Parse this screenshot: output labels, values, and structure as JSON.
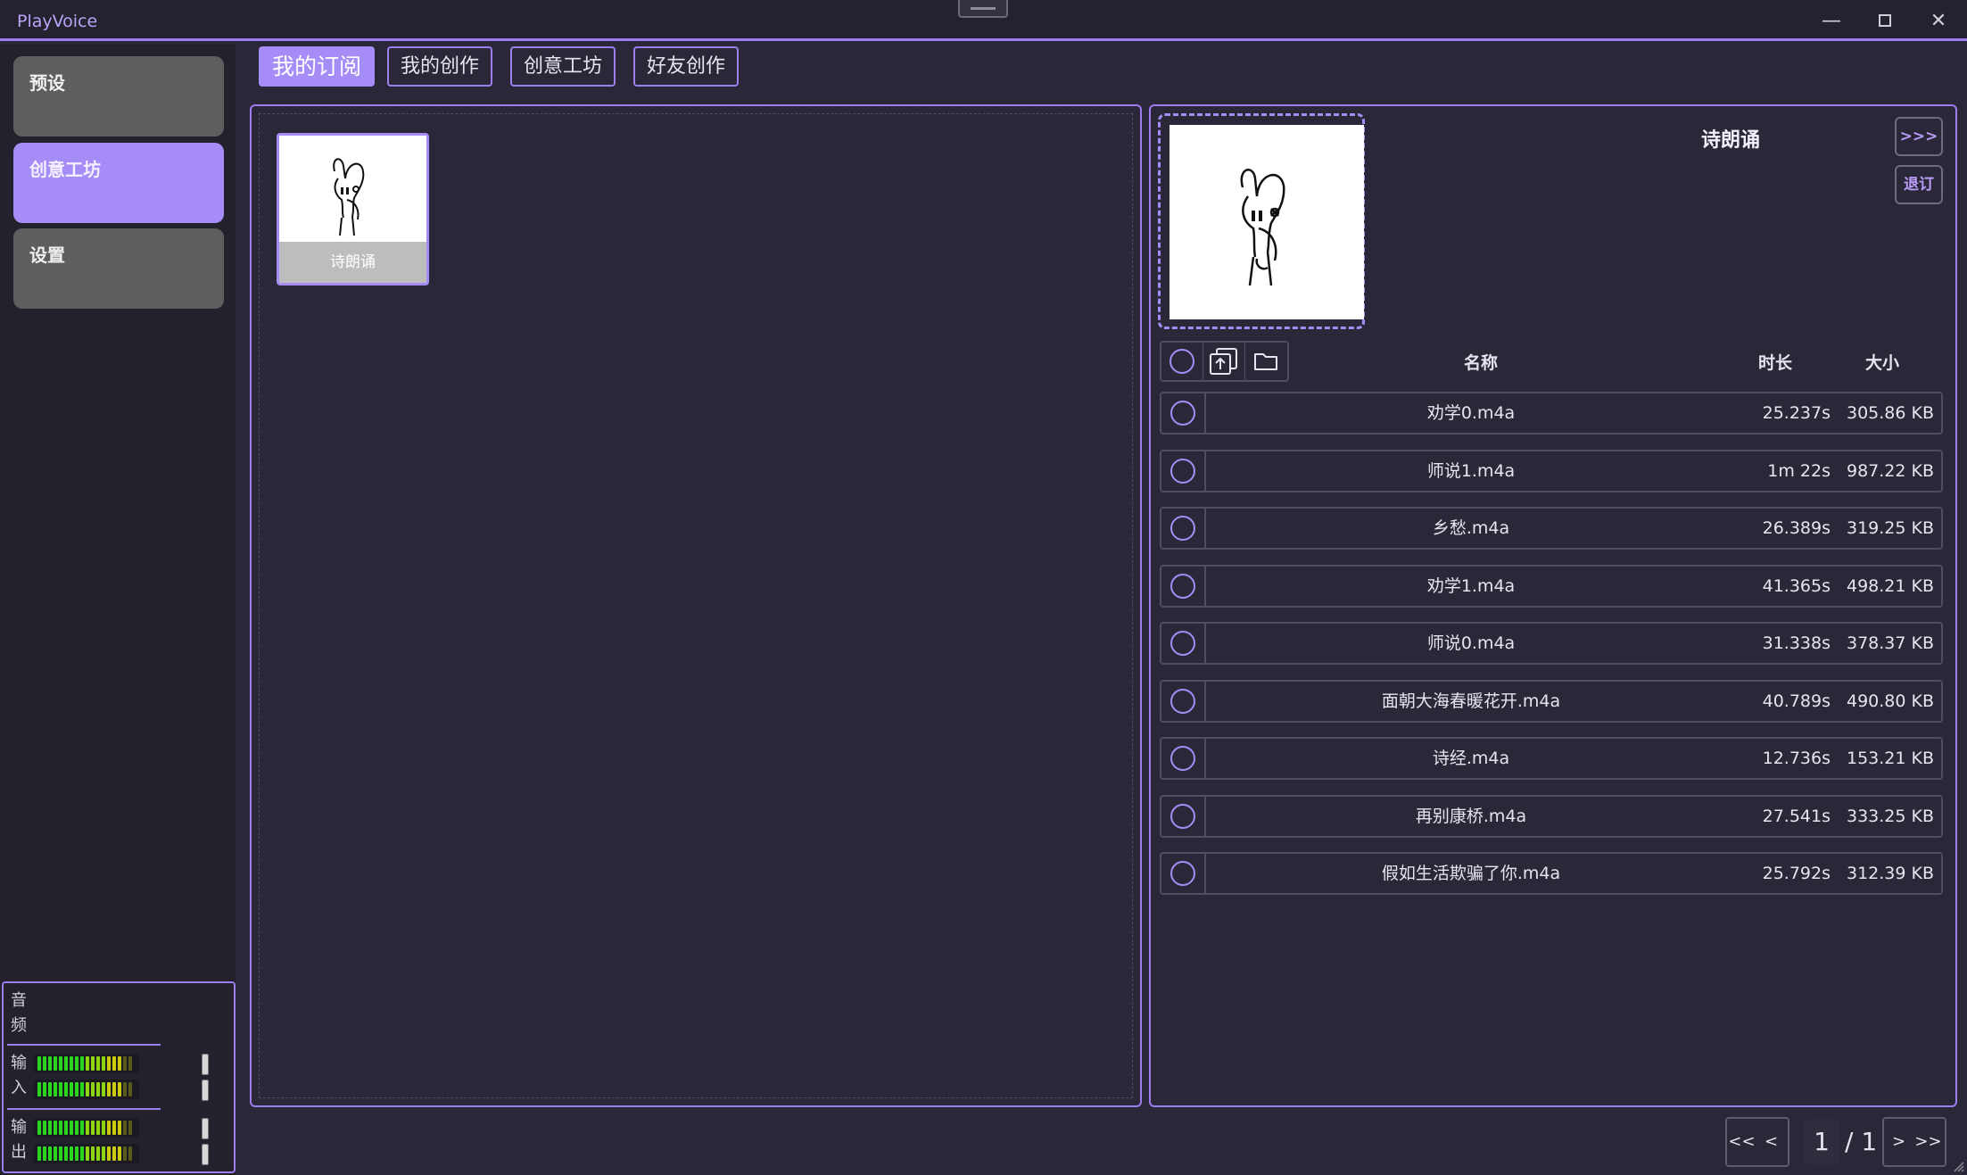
{
  "app": {
    "title": "PlayVoice"
  },
  "window": {
    "minimize": "—",
    "close": "✕"
  },
  "sidebar": {
    "items": [
      {
        "label": "预设",
        "active": false
      },
      {
        "label": "创意工坊",
        "active": true
      },
      {
        "label": "设置",
        "active": false
      }
    ]
  },
  "audio": {
    "title_line1": "音",
    "title_line2": "频",
    "input_line1": "输",
    "input_line2": "入",
    "output_line1": "输",
    "output_line2": "出"
  },
  "tabs": [
    {
      "label": "我的订阅",
      "active": true
    },
    {
      "label": "我的创作",
      "active": false
    },
    {
      "label": "创意工坊",
      "active": false
    },
    {
      "label": "好友创作",
      "active": false
    }
  ],
  "library": {
    "cards": [
      {
        "label": "诗朗诵"
      }
    ]
  },
  "detail": {
    "title": "诗朗诵",
    "expand_label": ">>>",
    "unsubscribe_label": "退订",
    "columns": {
      "name": "名称",
      "duration": "时长",
      "size": "大小"
    },
    "files": [
      {
        "name": "劝学0.m4a",
        "duration": "25.237s",
        "size": "305.86 KB"
      },
      {
        "name": "师说1.m4a",
        "duration": "1m 22s",
        "size": "987.22 KB"
      },
      {
        "name": "乡愁.m4a",
        "duration": "26.389s",
        "size": "319.25 KB"
      },
      {
        "name": "劝学1.m4a",
        "duration": "41.365s",
        "size": "498.21 KB"
      },
      {
        "name": "师说0.m4a",
        "duration": "31.338s",
        "size": "378.37 KB"
      },
      {
        "name": "面朝大海春暖花开.m4a",
        "duration": "40.789s",
        "size": "490.80 KB"
      },
      {
        "name": "诗经.m4a",
        "duration": "12.736s",
        "size": "153.21 KB"
      },
      {
        "name": "再别康桥.m4a",
        "duration": "27.541s",
        "size": "333.25 KB"
      },
      {
        "name": "假如生活欺骗了你.m4a",
        "duration": "25.792s",
        "size": "312.39 KB"
      }
    ]
  },
  "pagination": {
    "first": "<<",
    "prev": "<",
    "next": ">",
    "last": ">>",
    "current": "1",
    "total": "/ 1"
  },
  "colors": {
    "accent": "#a58cf6",
    "border": "#9c7ef0",
    "background": "#2a2838"
  },
  "icons": [
    "select-all-icon",
    "export-icon",
    "folder-icon",
    "row-select-icon"
  ]
}
